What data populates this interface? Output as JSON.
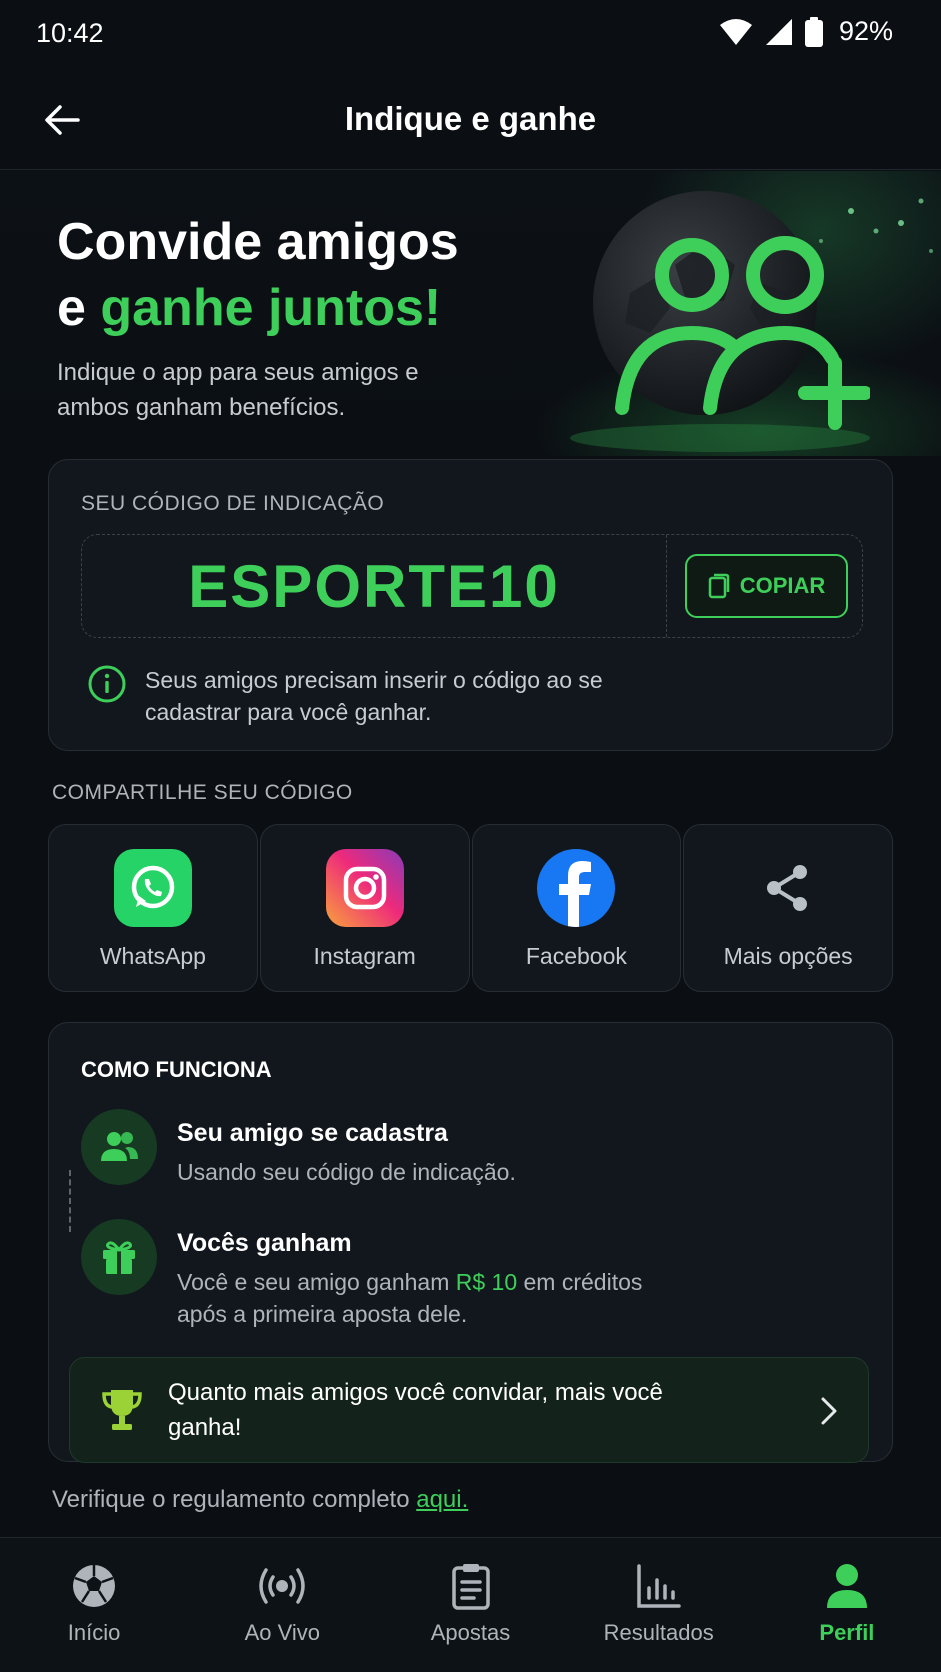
{
  "status_bar": {
    "time": "10:42",
    "battery": "92%"
  },
  "app_bar": {
    "title": "Indique e ganhe"
  },
  "hero": {
    "title_line1": "Convide amigos",
    "title_line2_prefix": "e ",
    "title_line2_accent": "ganhe juntos!",
    "subtitle": "Indique o app para seus amigos e ambos ganham benefícios."
  },
  "referral": {
    "label": "SEU CÓDIGO DE INDICAÇÃO",
    "code": "ESPORTE10",
    "copy_label": "COPIAR",
    "info": "Seus amigos precisam inserir o código ao se cadastrar para você ganhar."
  },
  "share": {
    "label": "COMPARTILHE SEU CÓDIGO",
    "items": [
      {
        "label": "WhatsApp",
        "icon": "whatsapp-icon"
      },
      {
        "label": "Instagram",
        "icon": "instagram-icon"
      },
      {
        "label": "Facebook",
        "icon": "facebook-icon"
      },
      {
        "label": "Mais opções",
        "icon": "share-icon"
      }
    ]
  },
  "how": {
    "title": "COMO FUNCIONA",
    "steps": [
      {
        "title": "Seu amigo se cadastra",
        "desc": "Usando seu código de indicação."
      },
      {
        "title": "Vocês ganham",
        "desc_before": "Você e seu amigo ganham ",
        "desc_money": "R$ 10",
        "desc_after": " em créditos após a primeira aposta dele."
      }
    ],
    "promo": "Quanto mais amigos você convidar, mais você ganha!"
  },
  "rules": {
    "text": "Verifique o regulamento completo ",
    "link": "aqui."
  },
  "nav": {
    "items": [
      {
        "label": "Início",
        "icon": "soccer-ball-icon"
      },
      {
        "label": "Ao Vivo",
        "icon": "live-broadcast-icon"
      },
      {
        "label": "Apostas",
        "icon": "clipboard-icon"
      },
      {
        "label": "Resultados",
        "icon": "bar-chart-icon"
      },
      {
        "label": "Perfil",
        "icon": "user-icon"
      }
    ],
    "active": "Perfil"
  },
  "colors": {
    "accent": "#3ecf5a",
    "background": "#0b0f13",
    "card": "#12171d"
  }
}
